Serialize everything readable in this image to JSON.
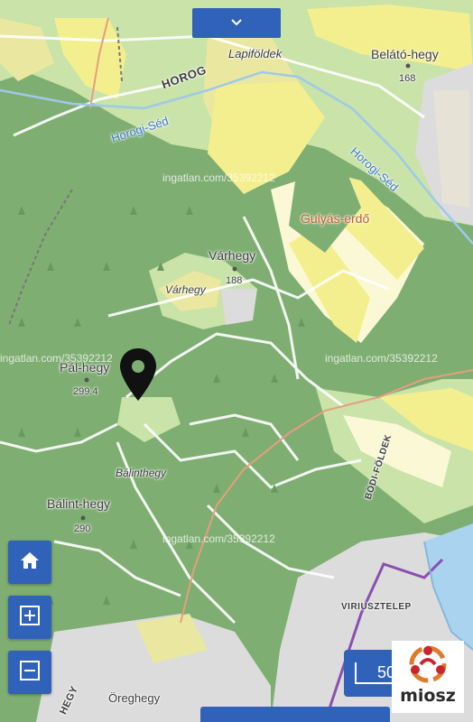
{
  "map": {
    "places": [
      {
        "key": "lapifoldek",
        "text": "Lapiföldek"
      },
      {
        "key": "horog",
        "text": "HOROG"
      },
      {
        "key": "belato_hegy",
        "text": "Belátó-hegy"
      },
      {
        "key": "belato_elev",
        "text": "168"
      },
      {
        "key": "horogi_sed_1",
        "text": "Horogi-Séd"
      },
      {
        "key": "horogi_sed_2",
        "text": "Horogi-Séd"
      },
      {
        "key": "gulyas_erdo",
        "text": "Gulyás-erdő"
      },
      {
        "key": "varhegy_peak",
        "text": "Várhegy"
      },
      {
        "key": "varhegy_elev",
        "text": "188"
      },
      {
        "key": "varhegy_area",
        "text": "Várhegy"
      },
      {
        "key": "pal_hegy",
        "text": "Pál-hegy"
      },
      {
        "key": "pal_elev",
        "text": "299.4"
      },
      {
        "key": "balinthegy_area",
        "text": "Bálinthegy"
      },
      {
        "key": "balint_hegy",
        "text": "Bálint-hegy"
      },
      {
        "key": "balint_elev",
        "text": "290"
      },
      {
        "key": "bodi_foldek",
        "text": "BÖDI-FÖLDEK"
      },
      {
        "key": "viriusztelep",
        "text": "VIRIUSZTELEP"
      },
      {
        "key": "oreghegy",
        "text": "Öreghegy"
      },
      {
        "key": "hegy",
        "text": "HEGY"
      }
    ],
    "watermark": "ingatlan.com/35392212",
    "scale_label": "50",
    "logo_text": "miosz",
    "colors": {
      "forest": "#7fae73",
      "meadow": "#c9e3a8",
      "farmland": "#f4ef8e",
      "pale_field": "#fbf8d6",
      "urban": "#dcdcdc",
      "water": "#aad3f0",
      "control": "#2f62b8",
      "boundary": "#8a4fb0",
      "marker": "#111111"
    },
    "controls": [
      {
        "key": "home",
        "icon": "home-icon"
      },
      {
        "key": "zoom_in",
        "icon": "plus-icon"
      },
      {
        "key": "zoom_out",
        "icon": "minus-icon"
      }
    ],
    "collapse_icon": "chevron-down-icon"
  }
}
